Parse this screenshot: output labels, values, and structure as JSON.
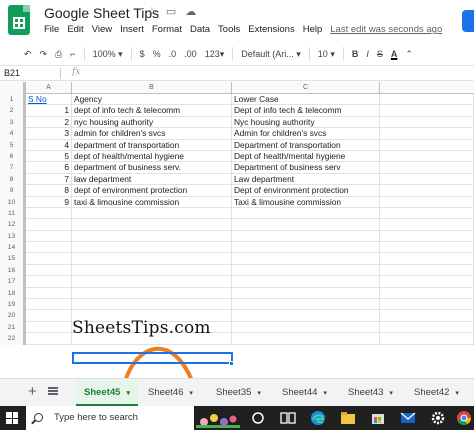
{
  "header": {
    "title": "Google Sheet Tips",
    "menu": [
      "File",
      "Edit",
      "View",
      "Insert",
      "Format",
      "Data",
      "Tools",
      "Extensions",
      "Help"
    ],
    "last_edit": "Last edit was seconds ago"
  },
  "toolbar": {
    "zoom": "100%",
    "currency": "$",
    "percent": "%",
    "dec_decrease": ".0",
    "dec_increase": ".00",
    "more_formats": "123",
    "font": "Default (Ari...",
    "font_size": "10",
    "bold": "B",
    "italic": "I",
    "strike": "S",
    "text_color": "A"
  },
  "formula_bar": {
    "name_box": "B21",
    "fx": "fx"
  },
  "columns": [
    "A",
    "B",
    "C"
  ],
  "rows": [
    {
      "n": "1",
      "a": "S No",
      "b": "Agency",
      "c": "Lower Case"
    },
    {
      "n": "2",
      "a": "1",
      "b": "dept of info tech & telecomm",
      "c": "Dept of info tech & telecomm"
    },
    {
      "n": "3",
      "a": "2",
      "b": "nyc housing authority",
      "c": "Nyc housing authority"
    },
    {
      "n": "4",
      "a": "3",
      "b": "admin for children's svcs",
      "c": "Admin for children's svcs"
    },
    {
      "n": "5",
      "a": "4",
      "b": "department of transportation",
      "c": "Department of transportation"
    },
    {
      "n": "6",
      "a": "5",
      "b": "dept of health/mental hygiene",
      "c": "Dept of health/mental hygiene"
    },
    {
      "n": "7",
      "a": "6",
      "b": "department of business serv.",
      "c": "Department of business serv"
    },
    {
      "n": "8",
      "a": "7",
      "b": "law department",
      "c": "Law department"
    },
    {
      "n": "9",
      "a": "8",
      "b": "dept of environment protection",
      "c": "Dept of environment protection"
    },
    {
      "n": "10",
      "a": "9",
      "b": "taxi & limousine commission",
      "c": "Taxi & limousine commission"
    },
    {
      "n": "11",
      "a": "",
      "b": "",
      "c": ""
    },
    {
      "n": "12",
      "a": "",
      "b": "",
      "c": ""
    },
    {
      "n": "13",
      "a": "",
      "b": "",
      "c": ""
    },
    {
      "n": "14",
      "a": "",
      "b": "",
      "c": ""
    },
    {
      "n": "15",
      "a": "",
      "b": "",
      "c": ""
    },
    {
      "n": "16",
      "a": "",
      "b": "",
      "c": ""
    },
    {
      "n": "17",
      "a": "",
      "b": "",
      "c": ""
    },
    {
      "n": "18",
      "a": "",
      "b": "",
      "c": ""
    },
    {
      "n": "19",
      "a": "",
      "b": "",
      "c": ""
    },
    {
      "n": "20",
      "a": "",
      "b": "",
      "c": ""
    },
    {
      "n": "21",
      "a": "",
      "b": "",
      "c": ""
    },
    {
      "n": "22",
      "a": "",
      "b": "",
      "c": ""
    }
  ],
  "watermark": "SheetsTips.com",
  "sheets": [
    "Sheet45",
    "Sheet46",
    "Sheet35",
    "Sheet44",
    "Sheet43",
    "Sheet42"
  ],
  "active_sheet": "Sheet45",
  "taskbar": {
    "search_placeholder": "Type here to search"
  },
  "colors": {
    "sheets_green": "#0f9d58",
    "active_tab": "#188038",
    "selection": "#1a73e8",
    "arc_orange": "#f07e1c"
  }
}
